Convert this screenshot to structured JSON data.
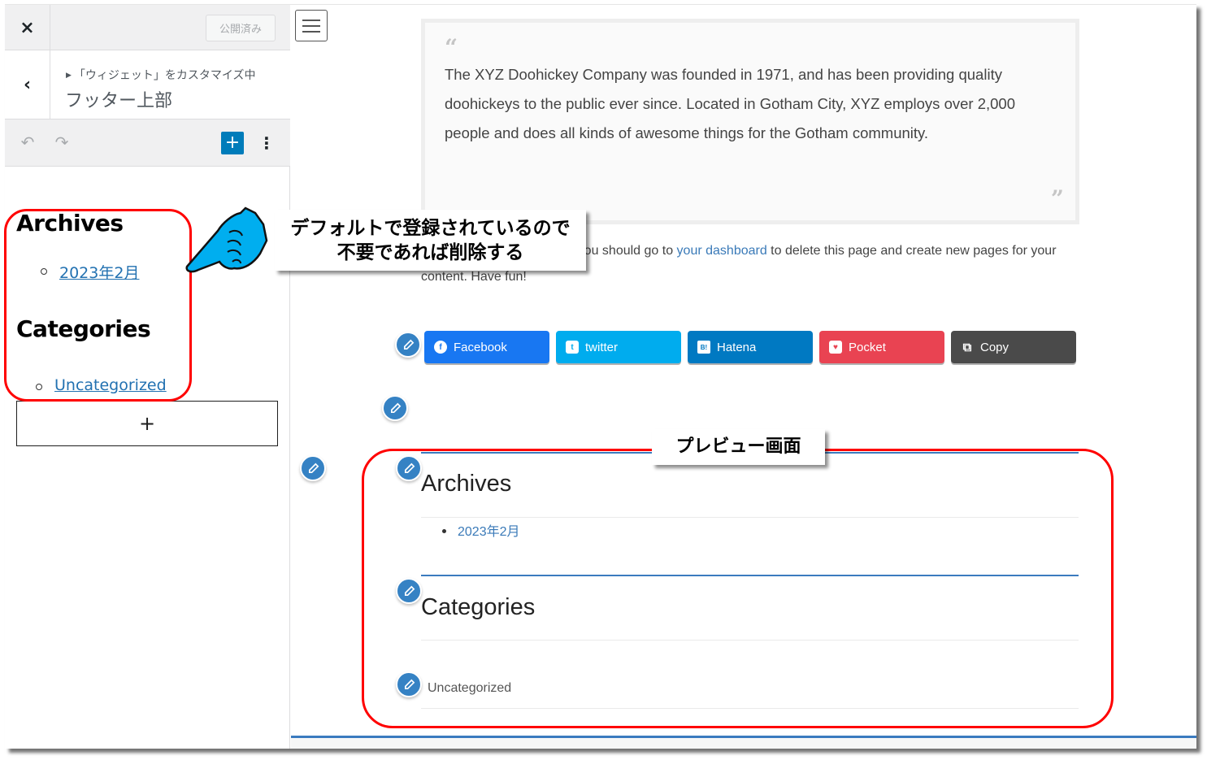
{
  "sidebar": {
    "close_icon": "×",
    "publish_button": "公開済み",
    "back_icon": "‹",
    "breadcrumb": "「ウィジェット」をカスタマイズ中",
    "section_title": "フッター上部",
    "toolbar": {
      "undo_icon": "↶",
      "redo_icon": "↷",
      "add_icon": "+",
      "more_icon": "⋮"
    },
    "widgets": [
      {
        "title": "Archives",
        "items": [
          "2023年2月"
        ]
      },
      {
        "title": "Categories",
        "items": [
          "Uncategorized"
        ]
      }
    ],
    "add_block_icon": "+"
  },
  "preview": {
    "menu_icon": "hamburger-menu",
    "quote": {
      "open_mark": "“",
      "text": "The XYZ Doohickey Company was founded in 1971, and has been providing quality doohickeys to the public ever since. Located in Gotham City, XYZ employs over 2,000 people and does all kinds of awesome things for the Gotham community.",
      "close_mark": "”"
    },
    "intro": {
      "before": "As a new WordPress user, you should go to ",
      "link": "your dashboard",
      "after": " to delete this page and create new pages for your content. Have fun!"
    },
    "share_buttons": [
      {
        "label": "Facebook",
        "icon": "f",
        "color": "#1877f2"
      },
      {
        "label": "twitter",
        "icon": "t",
        "color": "#00acee"
      },
      {
        "label": "Hatena",
        "icon": "B!",
        "color": "#0079c2"
      },
      {
        "label": "Pocket",
        "icon": "♥",
        "color": "#e94352"
      },
      {
        "label": "Copy",
        "icon": "⧉",
        "color": "#4a4a4a"
      }
    ],
    "footer_widgets": [
      {
        "title": "Archives",
        "items": [
          "2023年2月"
        ]
      },
      {
        "title": "Categories",
        "items": [
          "Uncategorized"
        ]
      }
    ]
  },
  "annotations": {
    "callout_delete": [
      "デフォルトで登録されているので",
      "不要であれば削除する"
    ],
    "callout_preview": "プレビュー画面",
    "highlight_color": "#ff0000",
    "pointer_color": "#00aeef"
  }
}
